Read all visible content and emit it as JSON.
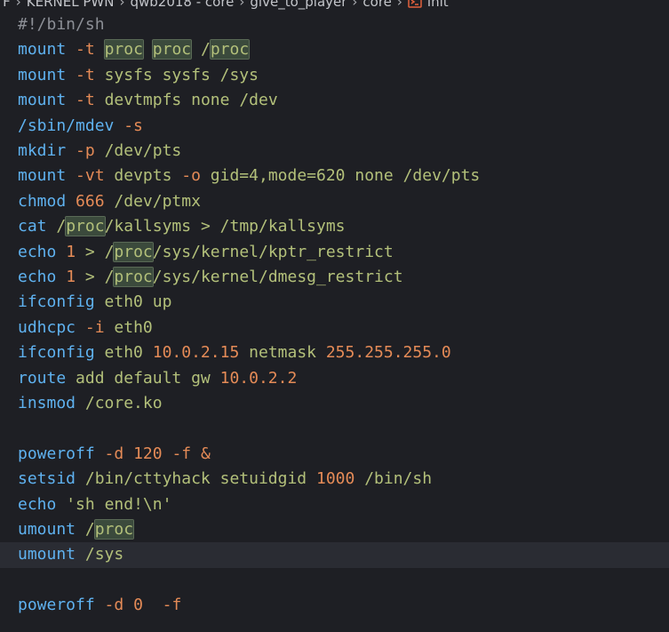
{
  "breadcrumb": {
    "items": [
      "TF",
      "KERNEL PWN",
      "qwb2018 - core",
      "give_to_player",
      "core"
    ],
    "file": "init",
    "file_icon": "shell-script-icon"
  },
  "editor": {
    "lines": [
      "#!/bin/sh",
      "mount -t proc proc /proc",
      "mount -t sysfs sysfs /sys",
      "mount -t devtmpfs none /dev",
      "/sbin/mdev -s",
      "mkdir -p /dev/pts",
      "mount -vt devpts -o gid=4,mode=620 none /dev/pts",
      "chmod 666 /dev/ptmx",
      "cat /proc/kallsyms > /tmp/kallsyms",
      "echo 1 > /proc/sys/kernel/kptr_restrict",
      "echo 1 > /proc/sys/kernel/dmesg_restrict",
      "ifconfig eth0 up",
      "udhcpc -i eth0",
      "ifconfig eth0 10.0.2.15 netmask 255.255.255.0",
      "route add default gw 10.0.2.2",
      "insmod /core.ko",
      "",
      "poweroff -d 120 -f &",
      "setsid /bin/cttyhack setuidgid 1000 /bin/sh",
      "echo 'sh end!\\n'",
      "umount /proc",
      "umount /sys",
      "",
      "poweroff -d 0  -f"
    ],
    "current_line": 21,
    "highlight_word": "proc"
  },
  "colors": {
    "background": "#1e1f24",
    "keyword": "#5fb2f0",
    "flag": "#e58b57",
    "text": "#b3c07a",
    "comment": "#8c8f96",
    "word_highlight": "#3b4a3c"
  }
}
